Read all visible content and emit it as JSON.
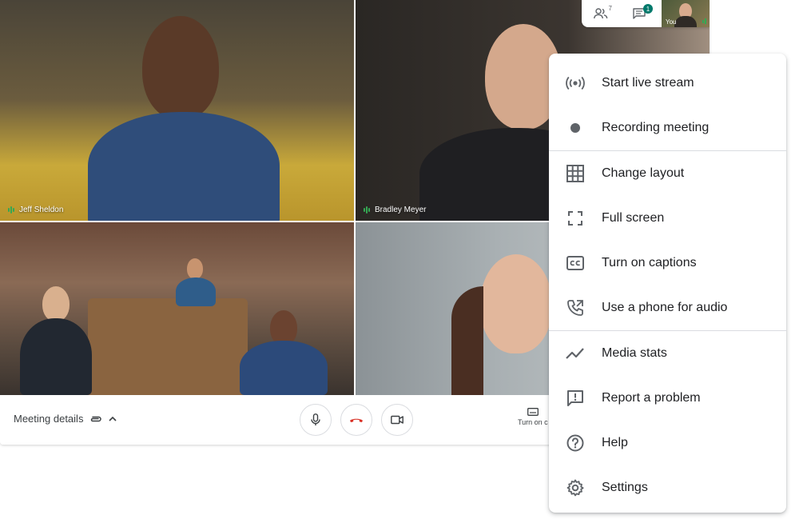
{
  "participants": {
    "tiles": [
      {
        "name": "Jeff Sheldon"
      },
      {
        "name": "Bradley Meyer"
      }
    ],
    "people_count": "7",
    "chat_badge": "1",
    "self_label": "You"
  },
  "bottom_bar": {
    "meeting_details": "Meeting details",
    "captions_label": "Turn on c"
  },
  "menu": {
    "items": [
      {
        "label": "Start live stream",
        "icon": "live-stream-icon"
      },
      {
        "label": "Recording meeting",
        "icon": "recording-dot-icon"
      },
      {
        "label": "Change layout",
        "icon": "grid-layout-icon"
      },
      {
        "label": "Full screen",
        "icon": "fullscreen-icon"
      },
      {
        "label": "Turn on captions",
        "icon": "captions-icon"
      },
      {
        "label": "Use a phone for audio",
        "icon": "phone-audio-icon"
      },
      {
        "label": "Media stats",
        "icon": "media-stats-icon"
      },
      {
        "label": "Report a problem",
        "icon": "report-problem-icon"
      },
      {
        "label": "Help",
        "icon": "help-icon"
      },
      {
        "label": "Settings",
        "icon": "settings-icon"
      }
    ]
  },
  "colors": {
    "hangup_red": "#d93025",
    "icon_gray": "#5f6368",
    "speaking_green": "#34a853",
    "chat_badge_teal": "#00796b"
  }
}
